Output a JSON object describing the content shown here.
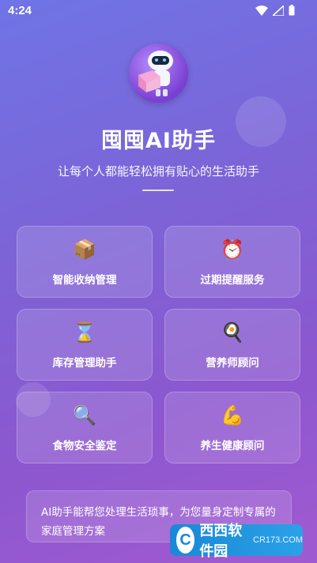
{
  "status_bar": {
    "time": "4:24"
  },
  "app": {
    "title": "囤囤AI助手",
    "subtitle": "让每个人都能轻松拥有贴心的生活助手"
  },
  "features": [
    {
      "label": "智能收纳管理",
      "icon": "box-icon",
      "glyph": "📦"
    },
    {
      "label": "过期提醒服务",
      "icon": "alarm-clock-icon",
      "glyph": "⏰"
    },
    {
      "label": "库存管理助手",
      "icon": "hourglass-icon",
      "glyph": "⌛"
    },
    {
      "label": "营养师顾问",
      "icon": "frying-pan-icon",
      "glyph": "🍳"
    },
    {
      "label": "食物安全鉴定",
      "icon": "magnifier-icon",
      "glyph": "🔍"
    },
    {
      "label": "养生健康顾问",
      "icon": "muscle-icon",
      "glyph": "💪"
    }
  ],
  "info": {
    "text": "AI助手能帮您处理生活琐事，为您量身定制专属的家庭管理方案"
  },
  "watermark": {
    "name": "西西软件园",
    "url": "CR173.COM"
  },
  "colors": {
    "accent_start": "#6f74e6",
    "accent_end": "#a15ad1"
  }
}
